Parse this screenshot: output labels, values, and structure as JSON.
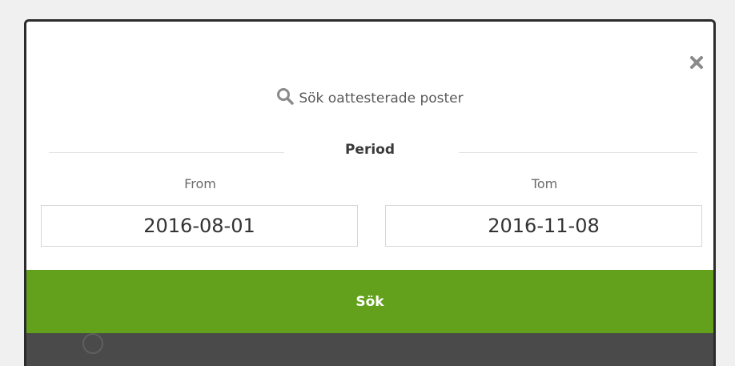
{
  "modal": {
    "title": "Sök oattesterade poster",
    "section_label": "Period",
    "from_label": "From",
    "to_label": "Tom",
    "from_value": "2016-08-01",
    "to_value": "2016-11-08",
    "submit_label": "Sök",
    "close_icon": "close-icon",
    "search_icon": "search-icon"
  },
  "colors": {
    "accent_green": "#63a11c",
    "backdrop": "#4a4a4a",
    "modal_bg": "#ffffff"
  }
}
